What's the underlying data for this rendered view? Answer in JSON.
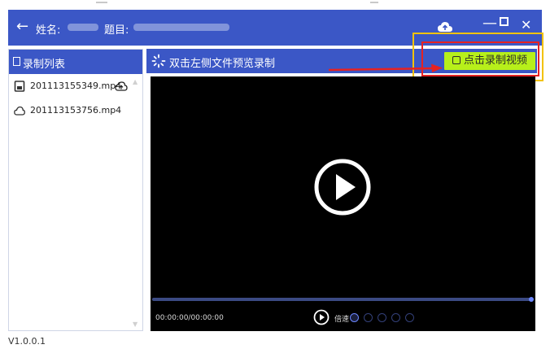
{
  "header": {
    "back_icon": "arrow-left-icon",
    "name_label": "姓名:",
    "topic_label": "题目:",
    "window_controls": [
      "minimize-icon",
      "maximize-icon",
      "close-icon"
    ]
  },
  "sidebar": {
    "title": "录制列表",
    "files": [
      {
        "name": "201113155349.mp4",
        "icon": "document-icon",
        "status_icon": "cloud-upload-icon"
      },
      {
        "name": "201113153756.mp4",
        "icon": "cloud-icon"
      }
    ]
  },
  "main": {
    "title": "双击左侧文件预览录制",
    "record_button": "点击录制视频",
    "player": {
      "time": "00:00:00/00:00:00",
      "speed_label": "倍速",
      "speed_options": 5
    }
  },
  "footer": {
    "version": "V1.0.0.1"
  },
  "colors": {
    "header_bg": "#3b57c6",
    "record_btn": "#b7f01a",
    "annotation_yellow": "#f2c200",
    "annotation_red": "#e62222"
  }
}
